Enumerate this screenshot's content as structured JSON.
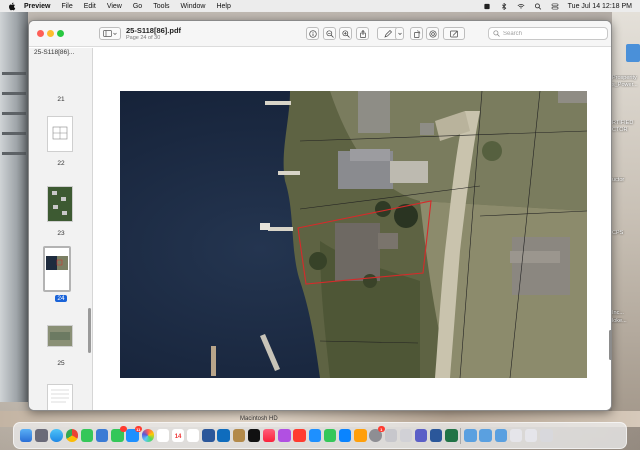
{
  "menubar": {
    "app_name": "Preview",
    "menus": [
      "File",
      "Edit",
      "View",
      "Go",
      "Tools",
      "Window",
      "Help"
    ],
    "clock": "Tue Jul 14  12:18 PM"
  },
  "window": {
    "title": "25-S118[86].pdf",
    "subtitle": "Page 24 of 30",
    "search_placeholder": "Search"
  },
  "sidebar": {
    "header": "25-S118[86]...",
    "pages": [
      {
        "label": "21"
      },
      {
        "label": "22"
      },
      {
        "label": "23"
      },
      {
        "label": "24",
        "selected": true
      },
      {
        "label": "25"
      }
    ]
  },
  "desktop": {
    "disk_label": "Macintosh HD",
    "right_labels": [
      "Prosperity",
      "s_Power...",
      "RTIFIED",
      "CTOR",
      "uctor",
      "CPS",
      "Inc...",
      "loke..."
    ]
  },
  "dock": {
    "badges": {
      "mail": "11",
      "calendar_date": "14",
      "news": "",
      "settings": "1"
    }
  },
  "colors": {
    "accent": "#1a63d8",
    "parcel_outline": "#d62a2a",
    "water": "#1e2b3e"
  }
}
